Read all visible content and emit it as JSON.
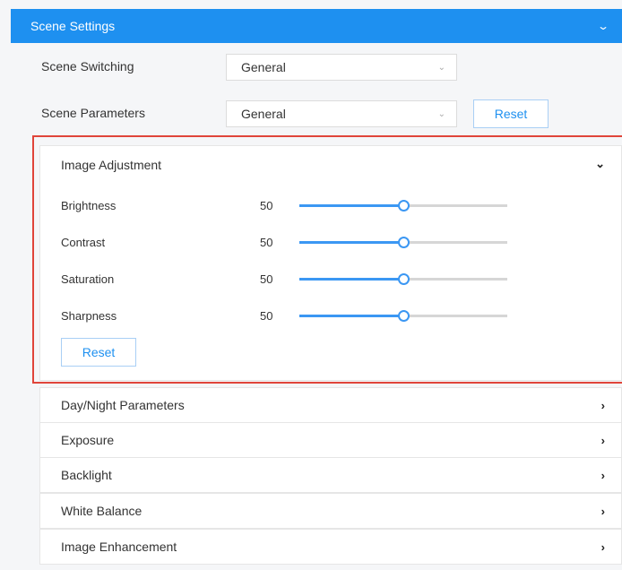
{
  "header": {
    "title": "Scene Settings",
    "toggle_icon": "chevron-down-icon"
  },
  "scene_switching": {
    "label": "Scene Switching",
    "value": "General"
  },
  "scene_parameters": {
    "label": "Scene Parameters",
    "value": "General",
    "reset_label": "Reset"
  },
  "image_adjustment": {
    "title": "Image Adjustment",
    "sliders": [
      {
        "label": "Brightness",
        "value": "50"
      },
      {
        "label": "Contrast",
        "value": "50"
      },
      {
        "label": "Saturation",
        "value": "50"
      },
      {
        "label": "Sharpness",
        "value": "50"
      }
    ],
    "reset_label": "Reset"
  },
  "sections": [
    {
      "label": "Day/Night Parameters"
    },
    {
      "label": "Exposure"
    },
    {
      "label": "Backlight"
    },
    {
      "label": "White Balance"
    },
    {
      "label": "Image Enhancement"
    }
  ],
  "colors": {
    "accent": "#1e90f0",
    "highlight": "#e0453a",
    "slider": "#3b97f3"
  }
}
